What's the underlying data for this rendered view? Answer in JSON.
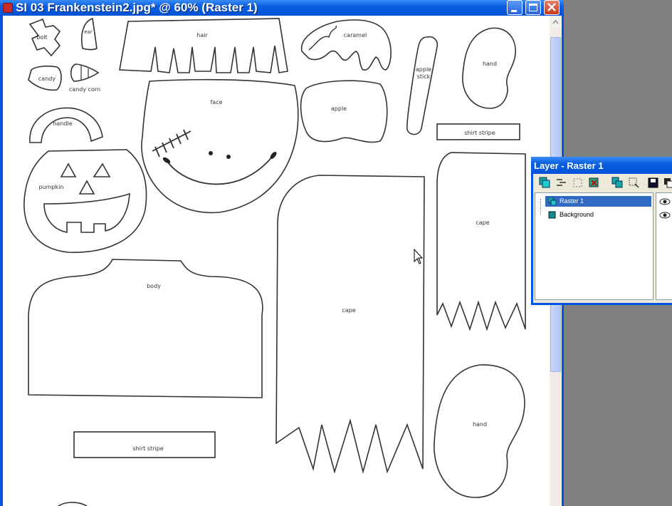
{
  "window": {
    "title": "SI 03 Frankenstein2.jpg* @  60% (Raster 1)",
    "buttons": [
      "minimize",
      "maximize",
      "close"
    ]
  },
  "canvas": {
    "labels": {
      "bolt": "bolt",
      "ear": "ear",
      "hair": "hair",
      "caramel": "caramel",
      "apple_stick": [
        "apple",
        "stick"
      ],
      "hand_top": "hand",
      "candy": "candy",
      "candy_corn": "candy corn",
      "face": "face",
      "apple": "apple",
      "handle": "handle",
      "shirt_stripe_right": "shirt stripe",
      "pumpkin": "pumpkin",
      "cape_right": "cape",
      "body": "body",
      "cape_center": "cape",
      "hand_bottom": "hand",
      "shirt_stripe_bottom": "shirt stripe"
    }
  },
  "layer_palette": {
    "title": "Layer - Raster 1",
    "layers": [
      {
        "name": "Raster 1",
        "selected": true,
        "visible": true
      },
      {
        "name": "Background",
        "selected": false,
        "visible": true
      }
    ],
    "toolbar_icons": [
      "new-raster-layer-icon",
      "new-vector-layer-icon",
      "new-mask-layer-icon",
      "delete-layer-icon",
      "duplicate-layer-icon",
      "promote-layer-icon",
      "save-mask-icon",
      "load-mask-icon"
    ]
  },
  "colors": {
    "titlebar": "#0054e3",
    "selection": "#316ac5",
    "desktop": "#7f7f7f",
    "close_button": "#c63b1c"
  }
}
